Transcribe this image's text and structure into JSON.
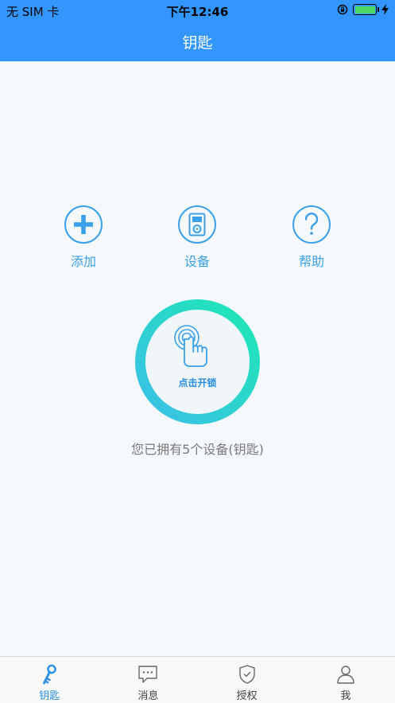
{
  "status_bar": {
    "carrier": "无 SIM 卡",
    "time": "下午12:46"
  },
  "nav": {
    "title": "钥匙"
  },
  "actions": [
    {
      "label": "添加",
      "icon": "plus-icon"
    },
    {
      "label": "设备",
      "icon": "device-icon"
    },
    {
      "label": "帮助",
      "icon": "question-icon"
    }
  ],
  "unlock": {
    "label": "点击开锁",
    "icon": "finger-tap-icon"
  },
  "device_count_text": "您已拥有5个设备(钥匙)",
  "tabs": [
    {
      "label": "钥匙",
      "icon": "key-icon",
      "active": true
    },
    {
      "label": "消息",
      "icon": "message-icon",
      "active": false
    },
    {
      "label": "授权",
      "icon": "shield-check-icon",
      "active": false
    },
    {
      "label": "我",
      "icon": "user-icon",
      "active": false
    }
  ],
  "colors": {
    "primary": "#3396ff",
    "accent": "#3aa0ec",
    "ring_start": "#3bbfe8",
    "ring_end": "#1de8b4",
    "background": "#f5f9fe"
  }
}
